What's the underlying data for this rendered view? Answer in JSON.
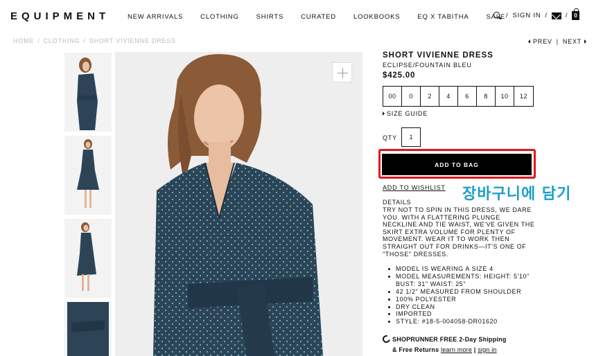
{
  "header": {
    "logo": "EQUIPMENT",
    "nav": [
      "NEW ARRIVALS",
      "CLOTHING",
      "SHIRTS",
      "CURATED",
      "LOOKBOOKS",
      "EQ X TABITHA",
      "SALE"
    ],
    "sign_in": "SIGN IN",
    "bag_count": "0",
    "separator": "/"
  },
  "breadcrumb": {
    "items": [
      "HOME",
      "CLOTHING",
      "SHORT VIVIENNE DRESS"
    ],
    "prev": "PREV",
    "next": "NEXT",
    "pipe": "|"
  },
  "product": {
    "name": "SHORT VIVIENNE DRESS",
    "color": "ECLIPSE/FOUNTAIN BLEU",
    "price": "$425.00",
    "sizes": [
      "00",
      "0",
      "2",
      "4",
      "6",
      "8",
      "10",
      "12"
    ],
    "size_guide": "SIZE GUIDE",
    "qty_label": "QTY",
    "qty_value": "1",
    "add_to_bag": "ADD TO BAG",
    "add_to_wishlist": "ADD TO WISHLIST",
    "details_label": "DETAILS",
    "details_text": "TRY NOT TO SPIN IN THIS DRESS, WE DARE YOU. WITH A FLATTERING PLUNGE NECKLINE AND TIE WAIST, WE'VE GIVEN THE SKIRT EXTRA VOLUME FOR PLENTY OF MOVEMENT. WEAR IT TO WORK THEN STRAIGHT OUT FOR DRINKS—IT'S ONE OF \"THOSE\" DRESSES.",
    "bullets": [
      "MODEL IS WEARING A SIZE 4",
      "MODEL MEASUREMENTS: HEIGHT: 5'10\" BUST: 31\" WAIST: 25\"",
      "42 1/2\" MEASURED FROM SHOULDER",
      "100% POLYESTER",
      "DRY CLEAN",
      "IMPORTED",
      "STYLE: #18-5-004058-DR01620"
    ]
  },
  "shoprunner": {
    "line1": "SHOPRUNNER FREE 2-Day Shipping",
    "line2_prefix": "& Free Returns",
    "learn_more": "learn more",
    "sep": "|",
    "sign_in": "sign in"
  },
  "annotation": {
    "text": "장바구니에 담기",
    "color": "#1a9fc9"
  },
  "colors": {
    "highlight_outline": "#e3141b",
    "dress": "#2d4457",
    "button": "#000000"
  }
}
